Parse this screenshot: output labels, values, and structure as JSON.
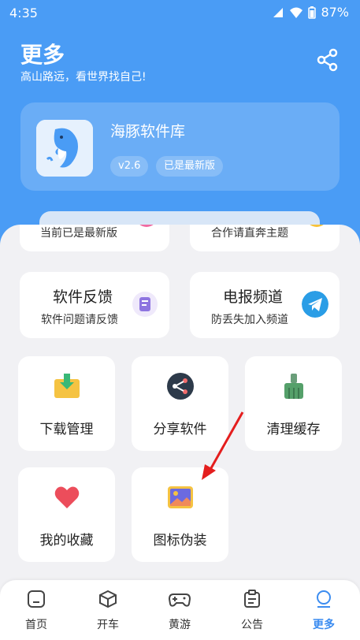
{
  "status_bar": {
    "time": "4:35",
    "battery": "87%"
  },
  "header": {
    "title": "更多",
    "subtitle": "高山路远，看世界找自己!"
  },
  "app_card": {
    "name": "海豚软件库",
    "version": "v2.6",
    "status": "已是最新版"
  },
  "partial_cards": [
    {
      "label": "当前已是最新版"
    },
    {
      "label": "合作请直奔主题"
    }
  ],
  "wide_cards": [
    {
      "title": "软件反馈",
      "subtitle": "软件问题请反馈",
      "icon": "feedback-icon"
    },
    {
      "title": "电报频道",
      "subtitle": "防丢失加入频道",
      "icon": "telegram-icon"
    }
  ],
  "grid_items": [
    {
      "label": "下载管理",
      "icon": "download-icon"
    },
    {
      "label": "分享软件",
      "icon": "share-icon"
    },
    {
      "label": "清理缓存",
      "icon": "broom-icon"
    },
    {
      "label": "我的收藏",
      "icon": "heart-icon"
    },
    {
      "label": "图标伪装",
      "icon": "image-icon"
    }
  ],
  "bottom_nav": [
    {
      "label": "首页",
      "icon": "home-icon"
    },
    {
      "label": "开车",
      "icon": "cube-icon"
    },
    {
      "label": "黄游",
      "icon": "gamepad-icon"
    },
    {
      "label": "公告",
      "icon": "notice-icon"
    },
    {
      "label": "更多",
      "icon": "more-icon",
      "active": true
    }
  ],
  "colors": {
    "primary": "#4a9cf5",
    "active_nav": "#3b8cf0",
    "telegram": "#2a9de6"
  }
}
